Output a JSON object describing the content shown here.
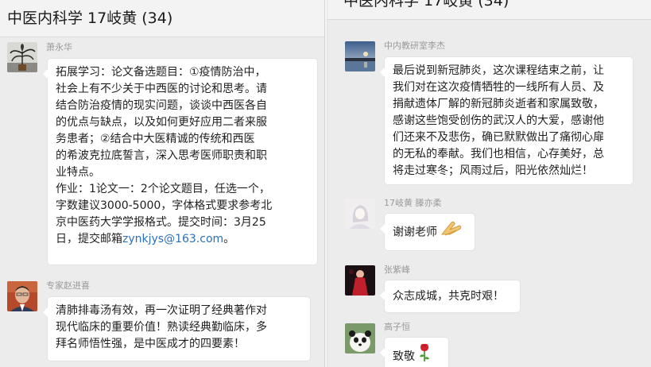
{
  "window": {
    "title": "中医内科学 17岐黄 (34)"
  },
  "left_messages": [
    {
      "sender": "萧永华",
      "avatar_icon": "plant-photo-avatar",
      "lines": [
        "拓展学习：论文备选题目：①疫情防治中，",
        "社会上有不少关于中西医的讨论和思考。请",
        "结合防治疫情的现实问题，谈谈中西医各自",
        "的优点与缺点，以及如何更好应用二者来服",
        "务患者；②结合中大医精诚的传统和西医",
        "的希波克拉底誓言，深入思考医师职责和职",
        "业特点。",
        "作业：1论文一：2个论文题目，任选一个，",
        "字数建议3000-5000，字体格式要求参考北",
        "京中医药大学学报格式。提交时间：3月25"
      ],
      "last_line_prefix": "日，提交邮箱",
      "email": "zynkjys@163.com",
      "last_line_suffix": "。"
    },
    {
      "sender": "专家赵进喜",
      "avatar_icon": "man-portrait-avatar",
      "lines": [
        "清肺排毒汤有效，再一次证明了经典著作对",
        "现代临床的重要价值！熟读经典勤临床，多",
        "拜名师悟性强，是中医成才的四要素！"
      ]
    }
  ],
  "right_messages": [
    {
      "sender": "中内教研室李杰",
      "avatar_icon": "sunset-lake-avatar",
      "lines": [
        "最后说到新冠肺炎，这次课程结束之前，让",
        "我们对在这次疫情牺牲的一线所有人员、及",
        "捐献遗体厂解的新冠肺炎逝者和家属致敬，",
        "感谢这些饱受创伤的武汉人的大爱，感谢他",
        "们还来不及悲伤，确已默默做出了痛彻心扉",
        "的无私的奉献。我们也相信，心存美好，总",
        "将走过寒冬；风雨过后，阳光依然灿烂！"
      ]
    },
    {
      "sender": "17岐黄 滕亦柔",
      "avatar_icon": "girl-sketch-avatar",
      "text": "谢谢老师",
      "emoji_icon": "praying-hands-emoji"
    },
    {
      "sender": "张紫峰",
      "avatar_icon": "red-dress-photo-avatar",
      "text": "众志成城，共克时艰！"
    },
    {
      "sender": "高子恒",
      "avatar_icon": "panda-avatar",
      "text": "致敬",
      "emoji_icon": "rose-emoji"
    }
  ],
  "colors": {
    "background": "#ececec",
    "bubble": "#ffffff",
    "link": "#2d6fbf",
    "sender_name": "#9a9a9a"
  }
}
